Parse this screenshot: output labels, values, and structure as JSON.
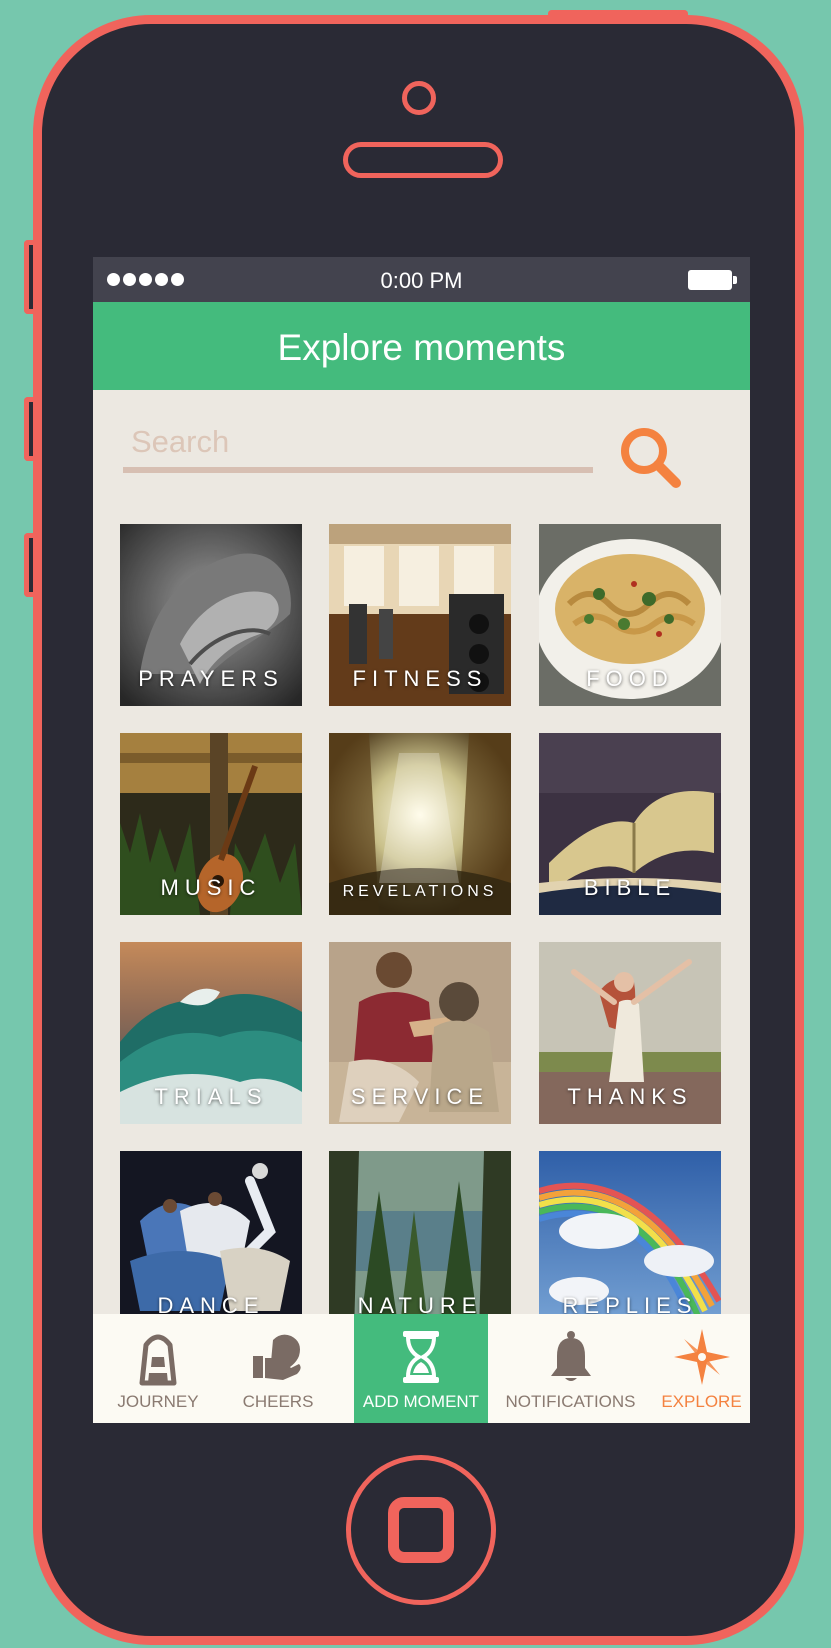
{
  "status_bar": {
    "time": "0:00 PM"
  },
  "header": {
    "title": "Explore moments"
  },
  "search": {
    "placeholder": "Search",
    "value": ""
  },
  "categories": [
    {
      "label": "PRAYERS"
    },
    {
      "label": "FITNESS"
    },
    {
      "label": "FOOD"
    },
    {
      "label": "MUSIC"
    },
    {
      "label": "REVELATIONS"
    },
    {
      "label": "BIBLE"
    },
    {
      "label": "TRIALS"
    },
    {
      "label": "SERVICE"
    },
    {
      "label": "THANKS"
    },
    {
      "label": "DANCE"
    },
    {
      "label": "NATURE"
    },
    {
      "label": "REPLIES"
    }
  ],
  "tabs": [
    {
      "label": "JOURNEY",
      "icon": "lighthouse-icon"
    },
    {
      "label": "CHEERS",
      "icon": "heart-hand-icon"
    },
    {
      "label": "ADD MOMENT",
      "icon": "hourglass-icon"
    },
    {
      "label": "NOTIFICATIONS",
      "icon": "bell-icon"
    },
    {
      "label": "EXPLORE",
      "icon": "compass-star-icon"
    }
  ],
  "colors": {
    "background": "#76c7ad",
    "phone_outline": "#f0645c",
    "phone_body": "#2a2a35",
    "header": "#44bb7d",
    "accent": "#f48240",
    "screen_bg": "#ece8e1",
    "tab_bar_bg": "#fcfaf3",
    "tab_icon": "#7a6b64"
  }
}
